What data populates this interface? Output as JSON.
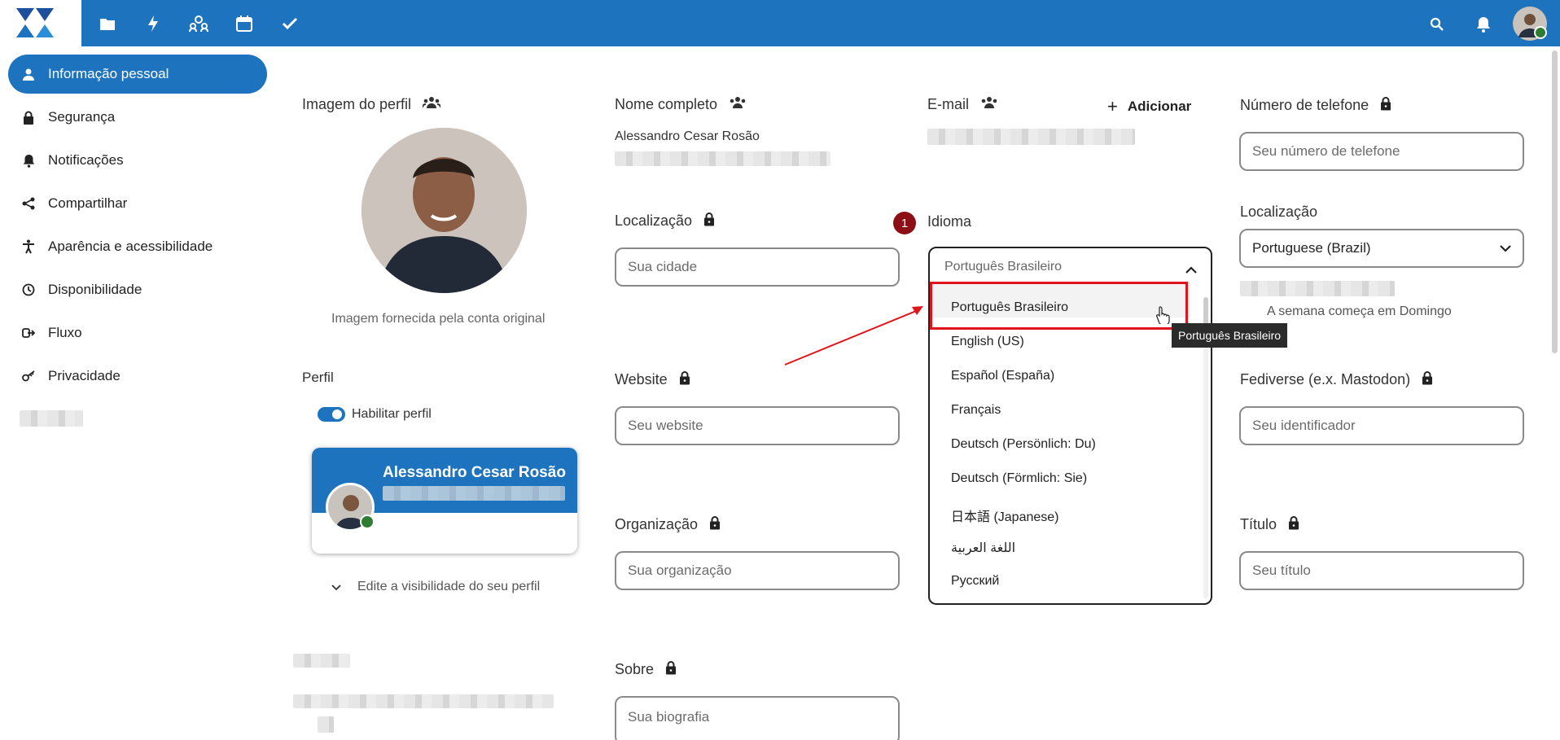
{
  "header": {
    "apps": [
      "folder-icon",
      "activity-icon",
      "contacts-icon",
      "calendar-icon",
      "tasks-icon"
    ],
    "accent": "#1e73be"
  },
  "sidebar": {
    "items": [
      {
        "label": "Informação pessoal",
        "icon": "person-icon",
        "active": true
      },
      {
        "label": "Segurança",
        "icon": "lock-icon"
      },
      {
        "label": "Notificações",
        "icon": "bell-icon"
      },
      {
        "label": "Compartilhar",
        "icon": "share-icon"
      },
      {
        "label": "Aparência e acessibilidade",
        "icon": "accessibility-icon"
      },
      {
        "label": "Disponibilidade",
        "icon": "clock-icon"
      },
      {
        "label": "Fluxo",
        "icon": "flow-icon"
      },
      {
        "label": "Privacidade",
        "icon": "key-icon"
      }
    ]
  },
  "profile": {
    "picture_label": "Imagem do perfil",
    "picture_caption": "Imagem fornecida pela conta original",
    "section_label": "Perfil",
    "enable_label": "Habilitar perfil",
    "card_name": "Alessandro Cesar Rosão",
    "visibility_label": "Edite a visibilidade do seu perfil"
  },
  "fields": {
    "fullname_label": "Nome completo",
    "fullname_value": "Alessandro Cesar Rosão",
    "email_label": "E-mail",
    "email_add": "Adicionar",
    "phone_label": "Número de telefone",
    "phone_placeholder": "Seu número de telefone",
    "location_label": "Localização",
    "location_placeholder": "Sua cidade",
    "language_label": "Idioma",
    "language_value": "Português Brasileiro",
    "locale_label": "Localização",
    "locale_value": "Portuguese (Brazil)",
    "week_start": "A semana começa em Domingo",
    "website_label": "Website",
    "website_placeholder": "Seu website",
    "fediverse_label": "Fediverse (e.x. Mastodon)",
    "fediverse_placeholder": "Seu identificador",
    "organization_label": "Organização",
    "organization_placeholder": "Sua organização",
    "title_label": "Título",
    "title_placeholder": "Seu título",
    "about_label": "Sobre",
    "about_placeholder": "Sua biografia"
  },
  "dropdown": {
    "options": [
      "Português Brasileiro",
      "English (US)",
      "Español (España)",
      "Français",
      "Deutsch (Persönlich: Du)",
      "Deutsch (Förmlich: Sie)",
      "日本語 (Japanese)",
      "اللغة العربية",
      "Русский"
    ],
    "tooltip": "Português Brasileiro"
  },
  "annotation": {
    "step": "1"
  }
}
